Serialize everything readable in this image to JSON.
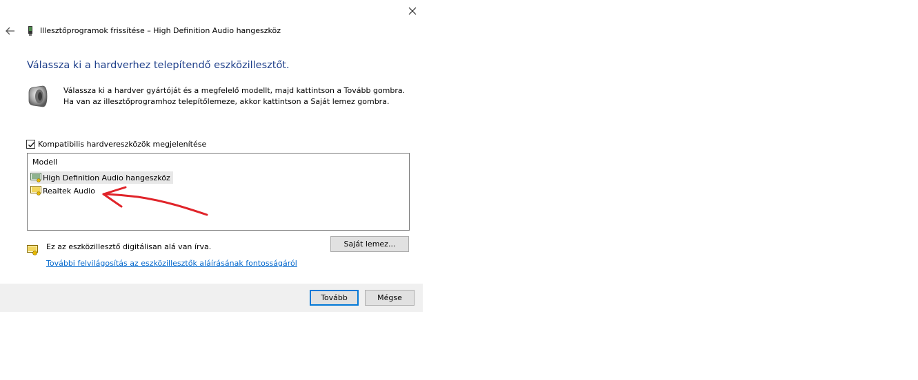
{
  "window": {
    "title": "Illesztőprogramok frissítése – High Definition Audio hangeszköz",
    "close_icon": "close-icon",
    "back_icon": "back-arrow-icon"
  },
  "main": {
    "heading": "Válassza ki a hardverhez telepítendő eszközillesztőt.",
    "description": "Válassza ki a hardver gyártóját és a megfelelő modellt, majd kattintson a Tovább gombra. Ha van az illesztőprogramhoz telepítőlemeze, akkor kattintson a Saját lemez gombra.",
    "speaker_icon": "speaker-icon"
  },
  "compatible_checkbox": {
    "label": "Kompatibilis hardvereszközök megjelenítése",
    "checked": true
  },
  "model_list": {
    "header": "Modell",
    "items": [
      {
        "label": "High Definition Audio hangeszköz",
        "selected": true
      },
      {
        "label": "Realtek Audio",
        "selected": false
      }
    ]
  },
  "signature": {
    "text": "Ez az eszközillesztő digitálisan alá van írva.",
    "link": "További felvilágosítás az eszközillesztők aláírásának fontosságáról"
  },
  "buttons": {
    "have_disk": "Saját lemez...",
    "next": "Tovább",
    "cancel": "Mégse"
  },
  "colors": {
    "heading": "#1e3f8a",
    "link": "#0066cc",
    "annotation_arrow": "#e0242a",
    "default_button_border": "#0078d7"
  }
}
